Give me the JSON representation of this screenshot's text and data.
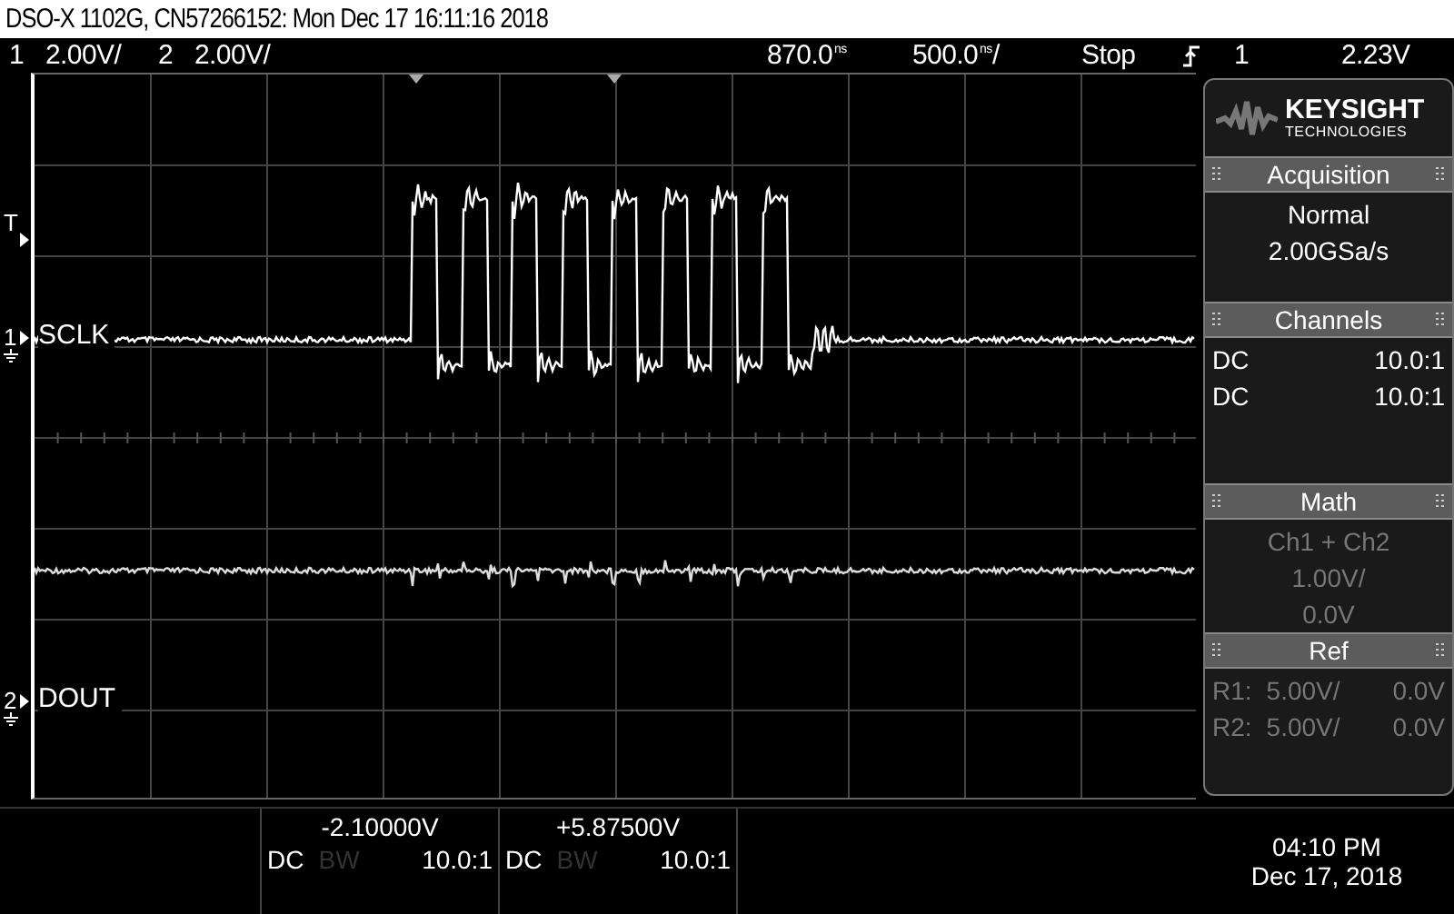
{
  "window": {
    "title": "DSO-X 1102G, CN57266152: Mon Dec 17 16:11:16 2018"
  },
  "status_bar": {
    "channels": [
      {
        "number": "1",
        "scale": "2.00V/"
      },
      {
        "number": "2",
        "scale": "2.00V/"
      }
    ],
    "delay": {
      "value": "870.0",
      "unit": "ns"
    },
    "timebase": {
      "value": "500.0",
      "unit": "ns",
      "suffix": "/"
    },
    "run_state": "Stop",
    "trigger": {
      "source": "1",
      "level": "2.23V"
    }
  },
  "display": {
    "trigger_marker": "T",
    "traces": [
      {
        "number": "1",
        "label": "SCLK",
        "kind": "clock"
      },
      {
        "number": "2",
        "label": "DOUT",
        "kind": "data"
      }
    ]
  },
  "panel": {
    "logo": {
      "brand": "KEYSIGHT",
      "sub": "TECHNOLOGIES"
    },
    "acquisition": {
      "title": "Acquisition",
      "lines": [
        "Normal",
        "2.00GSa/s"
      ]
    },
    "channels": {
      "title": "Channels",
      "rows": [
        {
          "coupling": "DC",
          "probe": "10.0:1"
        },
        {
          "coupling": "DC",
          "probe": "10.0:1"
        }
      ]
    },
    "math": {
      "title": "Math",
      "disabled": true,
      "lines": [
        "Ch1 + Ch2",
        "1.00V/",
        "0.0V"
      ]
    },
    "ref": {
      "title": "Ref",
      "disabled": true,
      "rows": [
        {
          "name": "R1:",
          "scale": "5.00V/",
          "offset": "0.0V"
        },
        {
          "name": "R2:",
          "scale": "5.00V/",
          "offset": "0.0V"
        }
      ]
    }
  },
  "channel_info": [
    {
      "offset": "-2.10000V",
      "coupling": "DC",
      "bw": "BW",
      "bw_limit": false,
      "probe": "10.0:1"
    },
    {
      "offset": "+5.87500V",
      "coupling": "DC",
      "bw": "BW",
      "bw_limit": false,
      "probe": "10.0:1"
    }
  ],
  "clock": {
    "time": "04:10 PM",
    "date": "Dec 17, 2018"
  }
}
